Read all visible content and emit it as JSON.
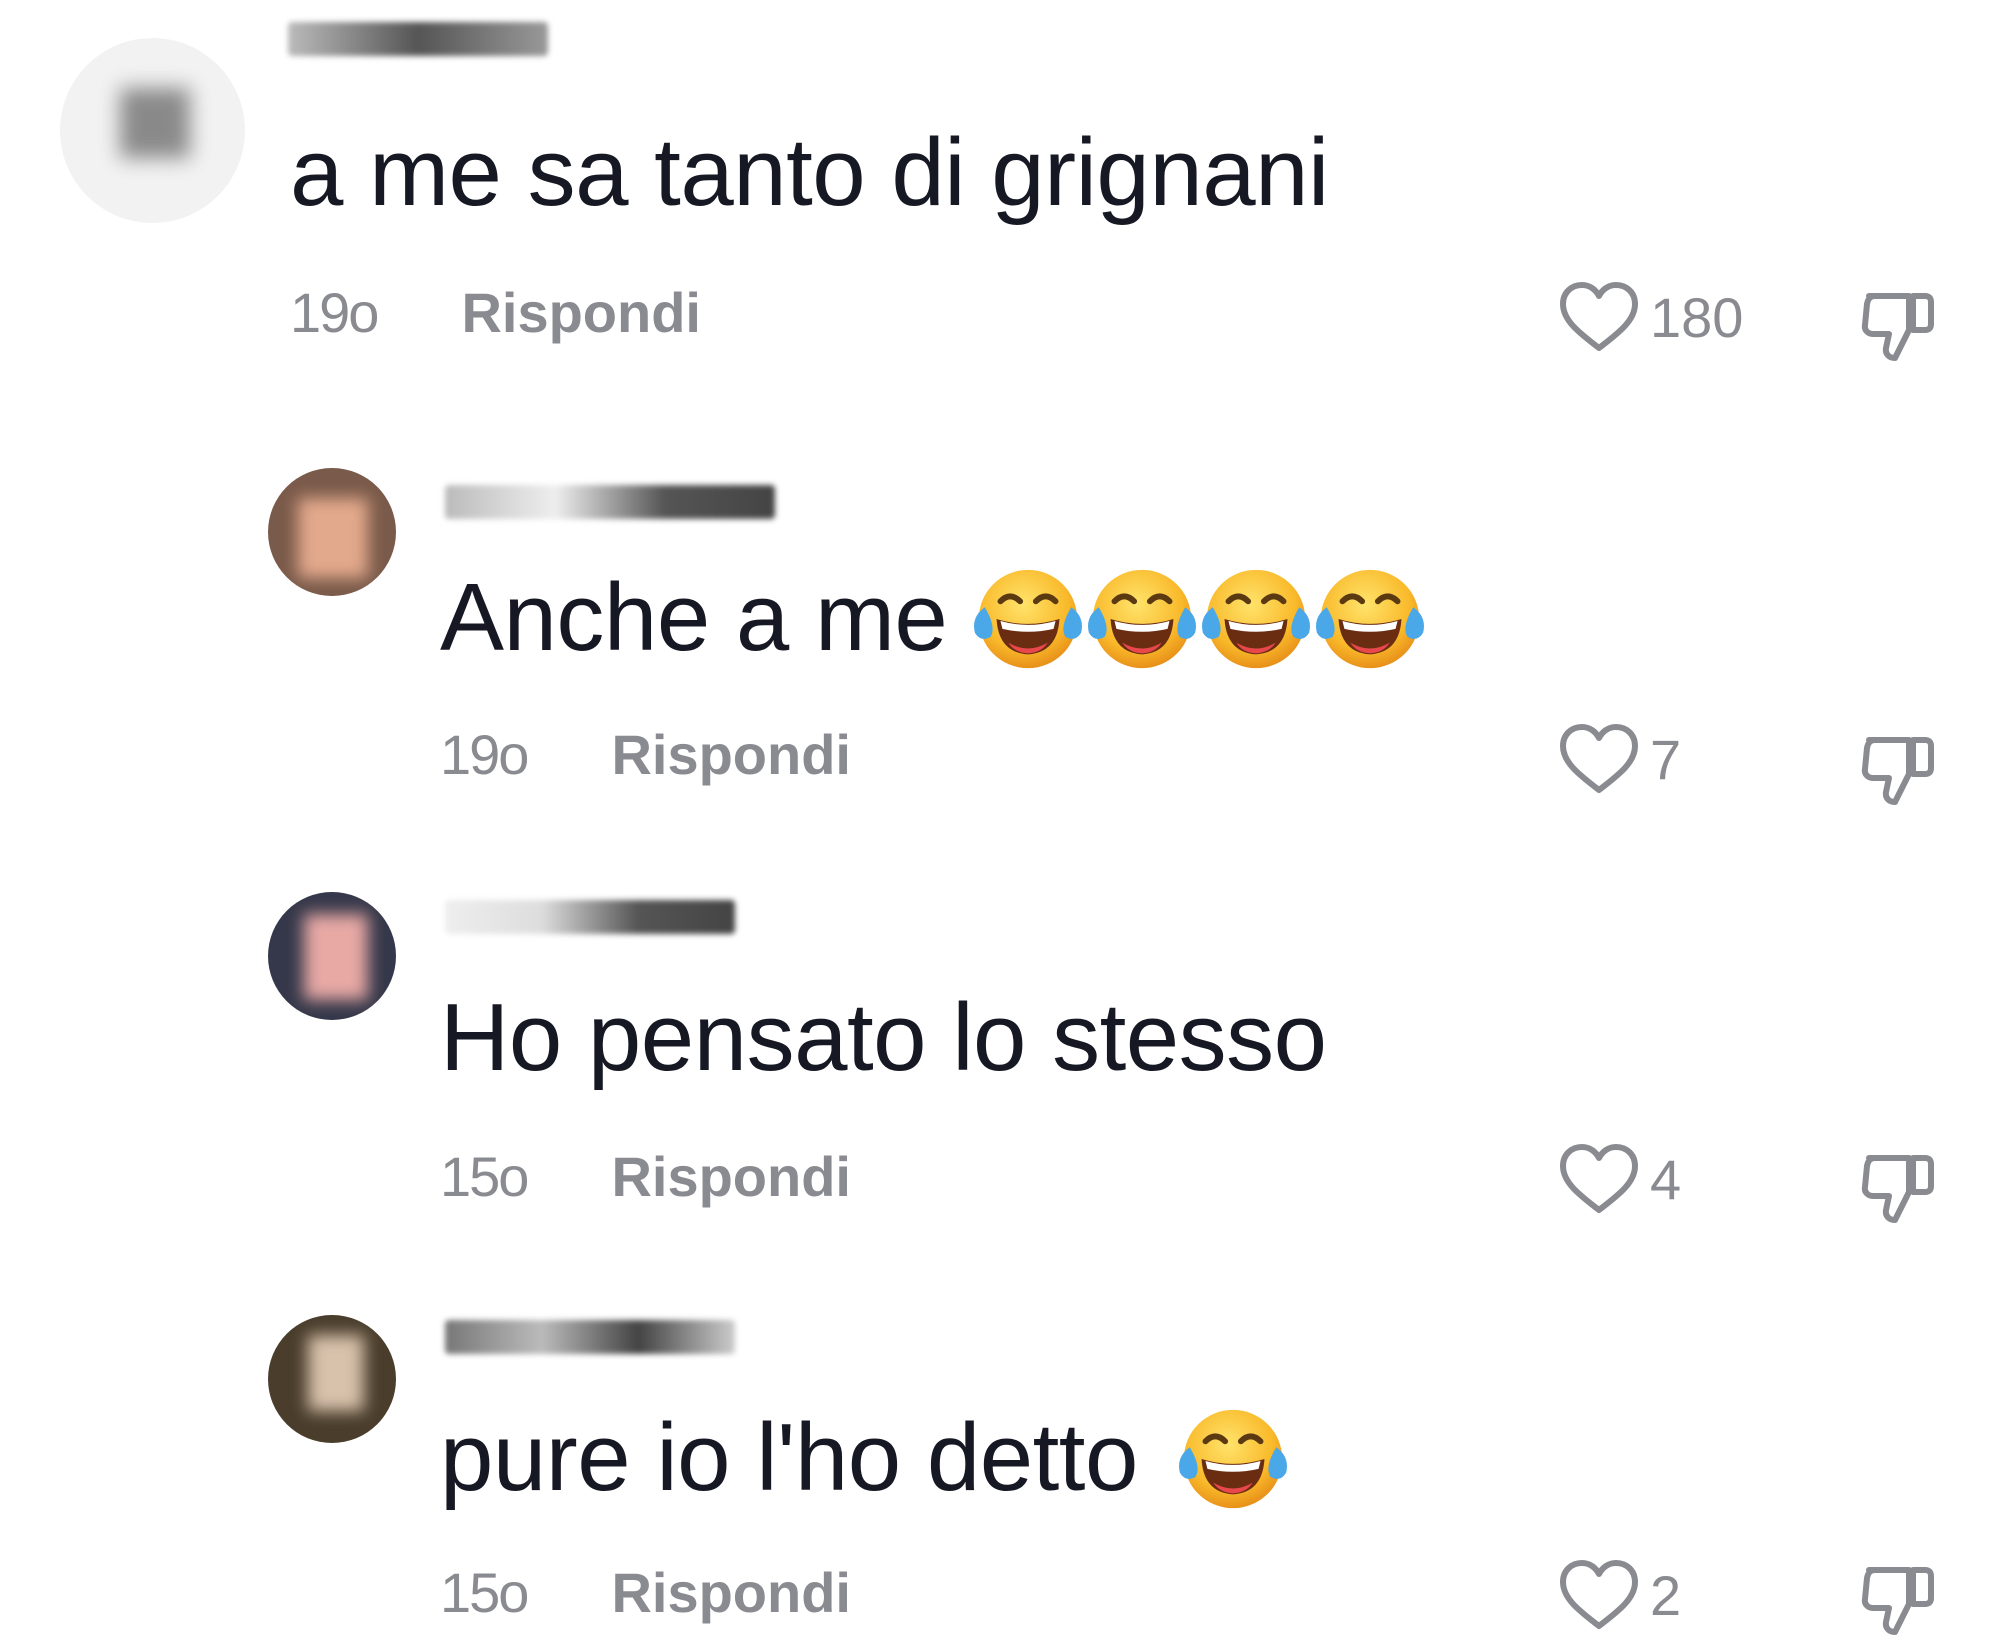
{
  "comments": [
    {
      "username": "",
      "text": "a me sa tanto di grignani",
      "emoji_count": 0,
      "age": "19o",
      "reply_label": "Rispondi",
      "likes": "180"
    },
    {
      "username": "",
      "text": "Anche a me",
      "emoji_count": 4,
      "age": "19o",
      "reply_label": "Rispondi",
      "likes": "7"
    },
    {
      "username": "",
      "text": "Ho pensato lo stesso",
      "emoji_count": 0,
      "age": "15o",
      "reply_label": "Rispondi",
      "likes": "4"
    },
    {
      "username": "",
      "text": "pure io l'ho detto",
      "emoji_count": 1,
      "age": "15o",
      "reply_label": "Rispondi",
      "likes": "2"
    }
  ],
  "icons": {
    "like": "heart-outline-icon",
    "dislike": "thumbs-down-icon",
    "emoji": "face-with-tears-of-joy-emoji"
  },
  "colors": {
    "text": "#161823",
    "secondary": "#8a8b91"
  }
}
